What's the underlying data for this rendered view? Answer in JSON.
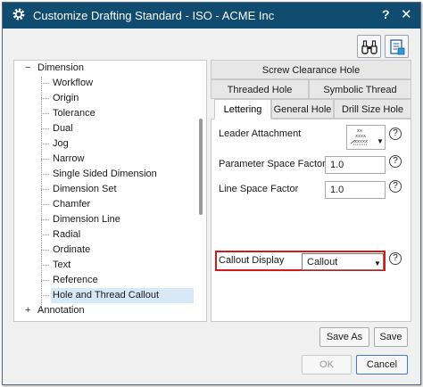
{
  "window": {
    "title": "Customize Drafting Standard - ISO - ACME Inc",
    "help_glyph": "?",
    "close_glyph": "✕",
    "title_bar_color": "#0f4c6f"
  },
  "toolbar": {
    "icons": [
      "find-binoculars-icon",
      "customize-document-icon"
    ]
  },
  "tree": {
    "root": {
      "expander": "−",
      "label": "Dimension"
    },
    "items": [
      {
        "label": "Workflow"
      },
      {
        "label": "Origin"
      },
      {
        "label": "Tolerance"
      },
      {
        "label": "Dual"
      },
      {
        "label": "Jog"
      },
      {
        "label": "Narrow"
      },
      {
        "label": "Single Sided Dimension"
      },
      {
        "label": "Dimension Set"
      },
      {
        "label": "Chamfer"
      },
      {
        "label": "Dimension Line"
      },
      {
        "label": "Radial"
      },
      {
        "label": "Ordinate"
      },
      {
        "label": "Text"
      },
      {
        "label": "Reference"
      },
      {
        "label": "Hole and Thread Callout",
        "selected": true
      }
    ],
    "next_root": {
      "expander": "+",
      "label": "Annotation"
    }
  },
  "tabs": {
    "row1": [
      "Screw Clearance Hole"
    ],
    "row2": [
      "Threaded Hole",
      "Symbolic Thread"
    ],
    "row3": [
      "Lettering",
      "General Hole",
      "Drill Size Hole"
    ],
    "active": "Lettering"
  },
  "properties": {
    "leader_attachment": {
      "label": "Leader Attachment"
    },
    "parameter_space_factor": {
      "label": "Parameter Space Factor",
      "value": "1.0"
    },
    "line_space_factor": {
      "label": "Line Space Factor",
      "value": "1.0"
    },
    "callout_display": {
      "label": "Callout Display",
      "value": "Callout"
    },
    "help_glyph": "?"
  },
  "buttons": {
    "save_as": "Save As",
    "save": "Save",
    "ok": "OK",
    "cancel": "Cancel"
  },
  "colors": {
    "highlight_box": "#d11a1a",
    "selection": "#d7e8f7"
  }
}
